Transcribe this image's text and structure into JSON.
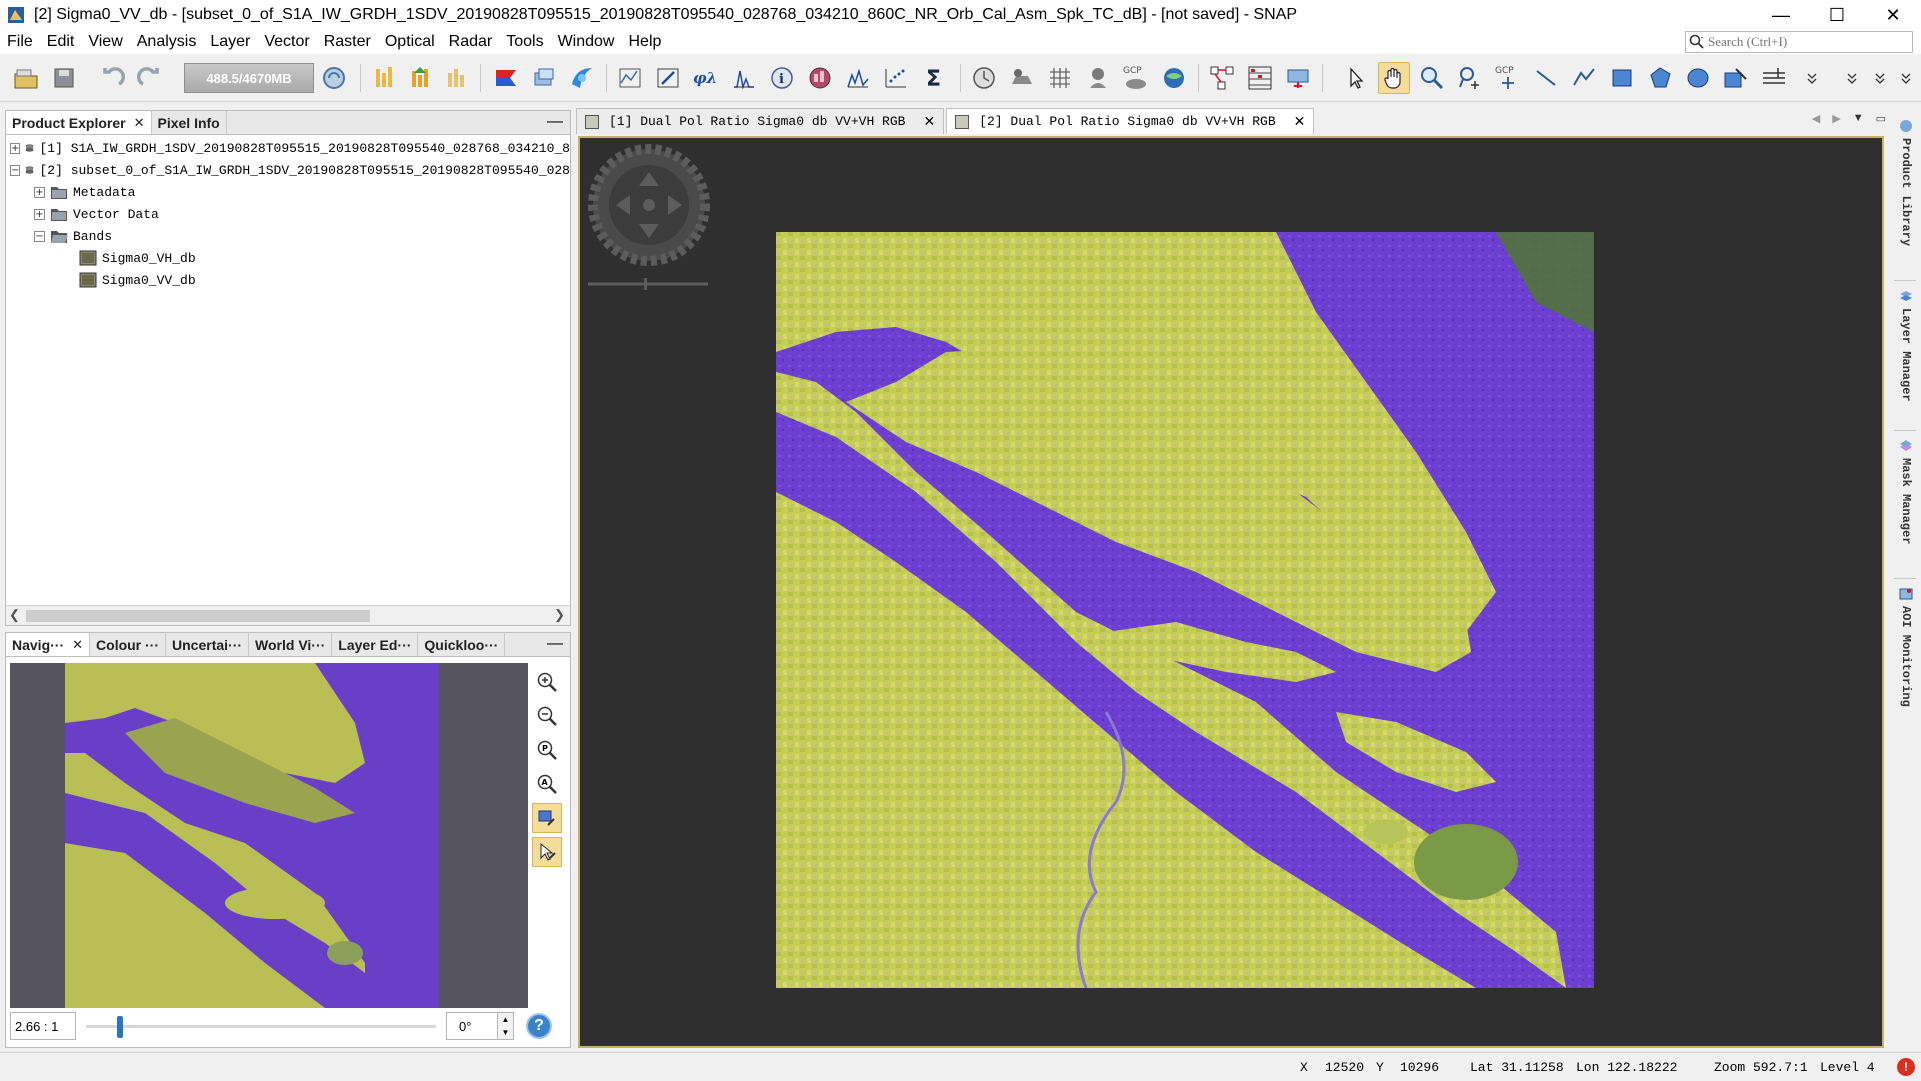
{
  "window": {
    "title": "[2] Sigma0_VV_db - [subset_0_of_S1A_IW_GRDH_1SDV_20190828T095515_20190828T095540_028768_034210_860C_NR_Orb_Cal_Asm_Spk_TC_dB] - [not saved] - SNAP",
    "controls": {
      "minimize": "—",
      "maximize": "☐",
      "close": "✕"
    }
  },
  "menu": {
    "items": [
      "File",
      "Edit",
      "View",
      "Analysis",
      "Layer",
      "Vector",
      "Raster",
      "Optical",
      "Radar",
      "Tools",
      "Window",
      "Help"
    ],
    "search_placeholder": "Search (Ctrl+I)"
  },
  "toolbar": {
    "memory": "488.5/4670MB"
  },
  "product_explorer": {
    "tabs": [
      {
        "label": "Product Explorer",
        "selected": true
      },
      {
        "label": "Pixel Info",
        "selected": false
      }
    ],
    "minimize": "—",
    "tree": [
      {
        "expander": "+",
        "icon": "product-icon",
        "label": "[1] S1A_IW_GRDH_1SDV_20190828T095515_20190828T095540_028768_034210_8"
      },
      {
        "expander": "−",
        "icon": "product-icon",
        "label": "[2] subset_0_of_S1A_IW_GRDH_1SDV_20190828T095515_20190828T095540_028"
      },
      {
        "expander": "+",
        "icon": "folder-icon",
        "label": "Metadata"
      },
      {
        "expander": "+",
        "icon": "folder-icon",
        "label": "Vector Data"
      },
      {
        "expander": "−",
        "icon": "folder-icon",
        "label": "Bands"
      },
      {
        "expander": "",
        "icon": "band-icon",
        "label": "Sigma0_VH_db"
      },
      {
        "expander": "",
        "icon": "band-icon",
        "label": "Sigma0_VV_db"
      }
    ]
  },
  "navigation": {
    "tabs": [
      {
        "label": "Navig···",
        "selected": true
      },
      {
        "label": "Colour ···",
        "selected": false
      },
      {
        "label": "Uncertai···",
        "selected": false
      },
      {
        "label": "World Vi···",
        "selected": false
      },
      {
        "label": "Layer Ed···",
        "selected": false
      },
      {
        "label": "Quickloo···",
        "selected": false
      }
    ],
    "minimize": "—",
    "scale_value": "2.66 : 1",
    "zoom_fraction": 0.09,
    "angle_value": "0°",
    "help": "?"
  },
  "image_view": {
    "tabs": [
      {
        "label": "[1] Dual Pol Ratio Sigma0 db VV+VH RGB",
        "selected": false
      },
      {
        "label": "[2] Dual Pol Ratio Sigma0 db VV+VH RGB",
        "selected": true
      }
    ]
  },
  "right_dock": {
    "items": [
      "Product Library",
      "Layer Manager",
      "Mask Manager",
      "AOI Monitoring"
    ]
  },
  "status": {
    "x_label": "X",
    "x_value": "12520",
    "y_label": "Y",
    "y_value": "10296",
    "lat": "Lat 31.11258",
    "lon": "Lon 122.18222",
    "zoom": "Zoom 592.7:1",
    "level": "Level 4"
  },
  "colors": {
    "land": "#c8cf5a",
    "water": "#6a3fc8",
    "accent": "#f4dc9b"
  }
}
